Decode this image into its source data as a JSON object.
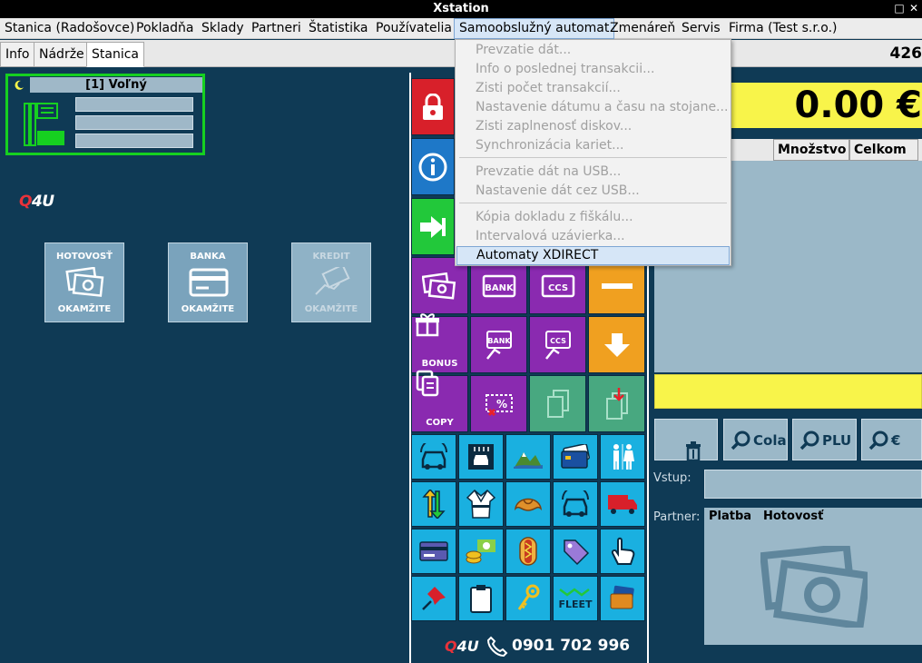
{
  "window": {
    "title": "Xstation",
    "restore_glyph": "□",
    "close_glyph": "✕"
  },
  "menu": [
    {
      "label": "Stanica (Radošovce)"
    },
    {
      "label": "Pokladňa"
    },
    {
      "label": "Sklady"
    },
    {
      "label": "Partneri"
    },
    {
      "label": "Štatistika"
    },
    {
      "label": "Používatelia"
    },
    {
      "label": "Samoobslužný automat"
    },
    {
      "label": "Zmenáreň"
    },
    {
      "label": "Servis"
    },
    {
      "label": "Firma (Test s.r.o.)"
    }
  ],
  "tabs": [
    {
      "label": "Info"
    },
    {
      "label": "Nádrže"
    },
    {
      "label": "Stanica"
    }
  ],
  "tabbar_right": "426",
  "pump": {
    "title": "[1] Voľný"
  },
  "brand": {
    "q": "Q",
    "rest": "4U",
    "phone": "0901 702 996"
  },
  "pay_buttons": [
    {
      "top": "HOTOVOSŤ",
      "bottom": "OKAMŽITE"
    },
    {
      "top": "BANKA",
      "bottom": "OKAMŽITE"
    },
    {
      "top": "KREDIT",
      "bottom": "OKAMŽITE"
    }
  ],
  "grid_labels": {
    "bank": "BANK",
    "ccs": "CCS",
    "bonus": "BONUS",
    "copy": "COPY",
    "percent": "%",
    "fleet": "FLEET"
  },
  "total": "0.00 €",
  "table_headers": [
    "Množstvo",
    "Celkom"
  ],
  "search_buttons": [
    {
      "label": "Cola"
    },
    {
      "label": "PLU"
    },
    {
      "label": "€"
    }
  ],
  "vstup_label": "Vstup:",
  "partner_label": "Partner:",
  "partner_info": {
    "platba": "Platba",
    "method": "Hotovosť"
  },
  "dropdown": {
    "items": [
      {
        "label": "Prevzatie dát..."
      },
      {
        "label": "Info o poslednej transakcii..."
      },
      {
        "label": "Zisti počet transakcií..."
      },
      {
        "label": "Nastavenie dátumu a času na stojane..."
      },
      {
        "label": "Zisti zaplnenosť diskov..."
      },
      {
        "label": "Synchronizácia kariet..."
      },
      {
        "label": "Prevzatie dát na USB..."
      },
      {
        "label": "Nastavenie dát cez USB..."
      },
      {
        "label": "Kópia dokladu z fiškálu..."
      },
      {
        "label": "Intervalová uzávierka..."
      },
      {
        "label": "Automaty XDIRECT"
      }
    ]
  }
}
